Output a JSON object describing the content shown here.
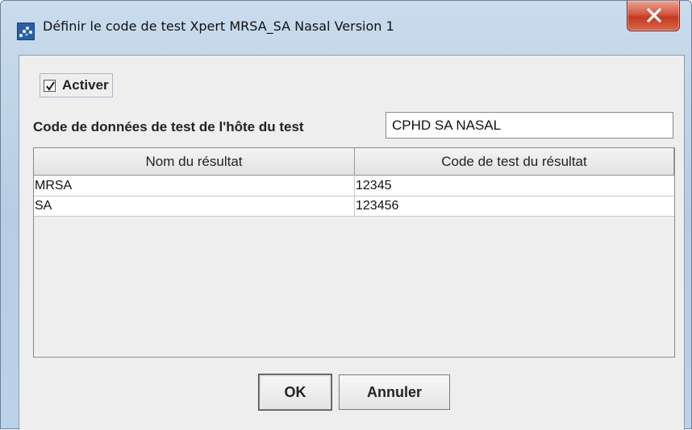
{
  "window": {
    "title": "Définir le code de test Xpert MRSA_SA Nasal Version 1",
    "close_icon": "close-x-icon",
    "app_icon": "dots-app-icon"
  },
  "form": {
    "enable_checkbox": {
      "label": "Activer",
      "checked": true
    },
    "host_code": {
      "label": "Code de données de test de l'hôte du test",
      "value": "CPHD SA NASAL"
    }
  },
  "table": {
    "columns": [
      "Nom du résultat",
      "Code de test du résultat"
    ],
    "rows": [
      [
        "MRSA",
        "12345"
      ],
      [
        "SA",
        "123456"
      ]
    ]
  },
  "buttons": {
    "ok_label": "OK",
    "cancel_label": "Annuler"
  },
  "colors": {
    "close_button": "#c23a22",
    "client_bg": "#eeeeee",
    "frame": "#bcd2e8"
  }
}
